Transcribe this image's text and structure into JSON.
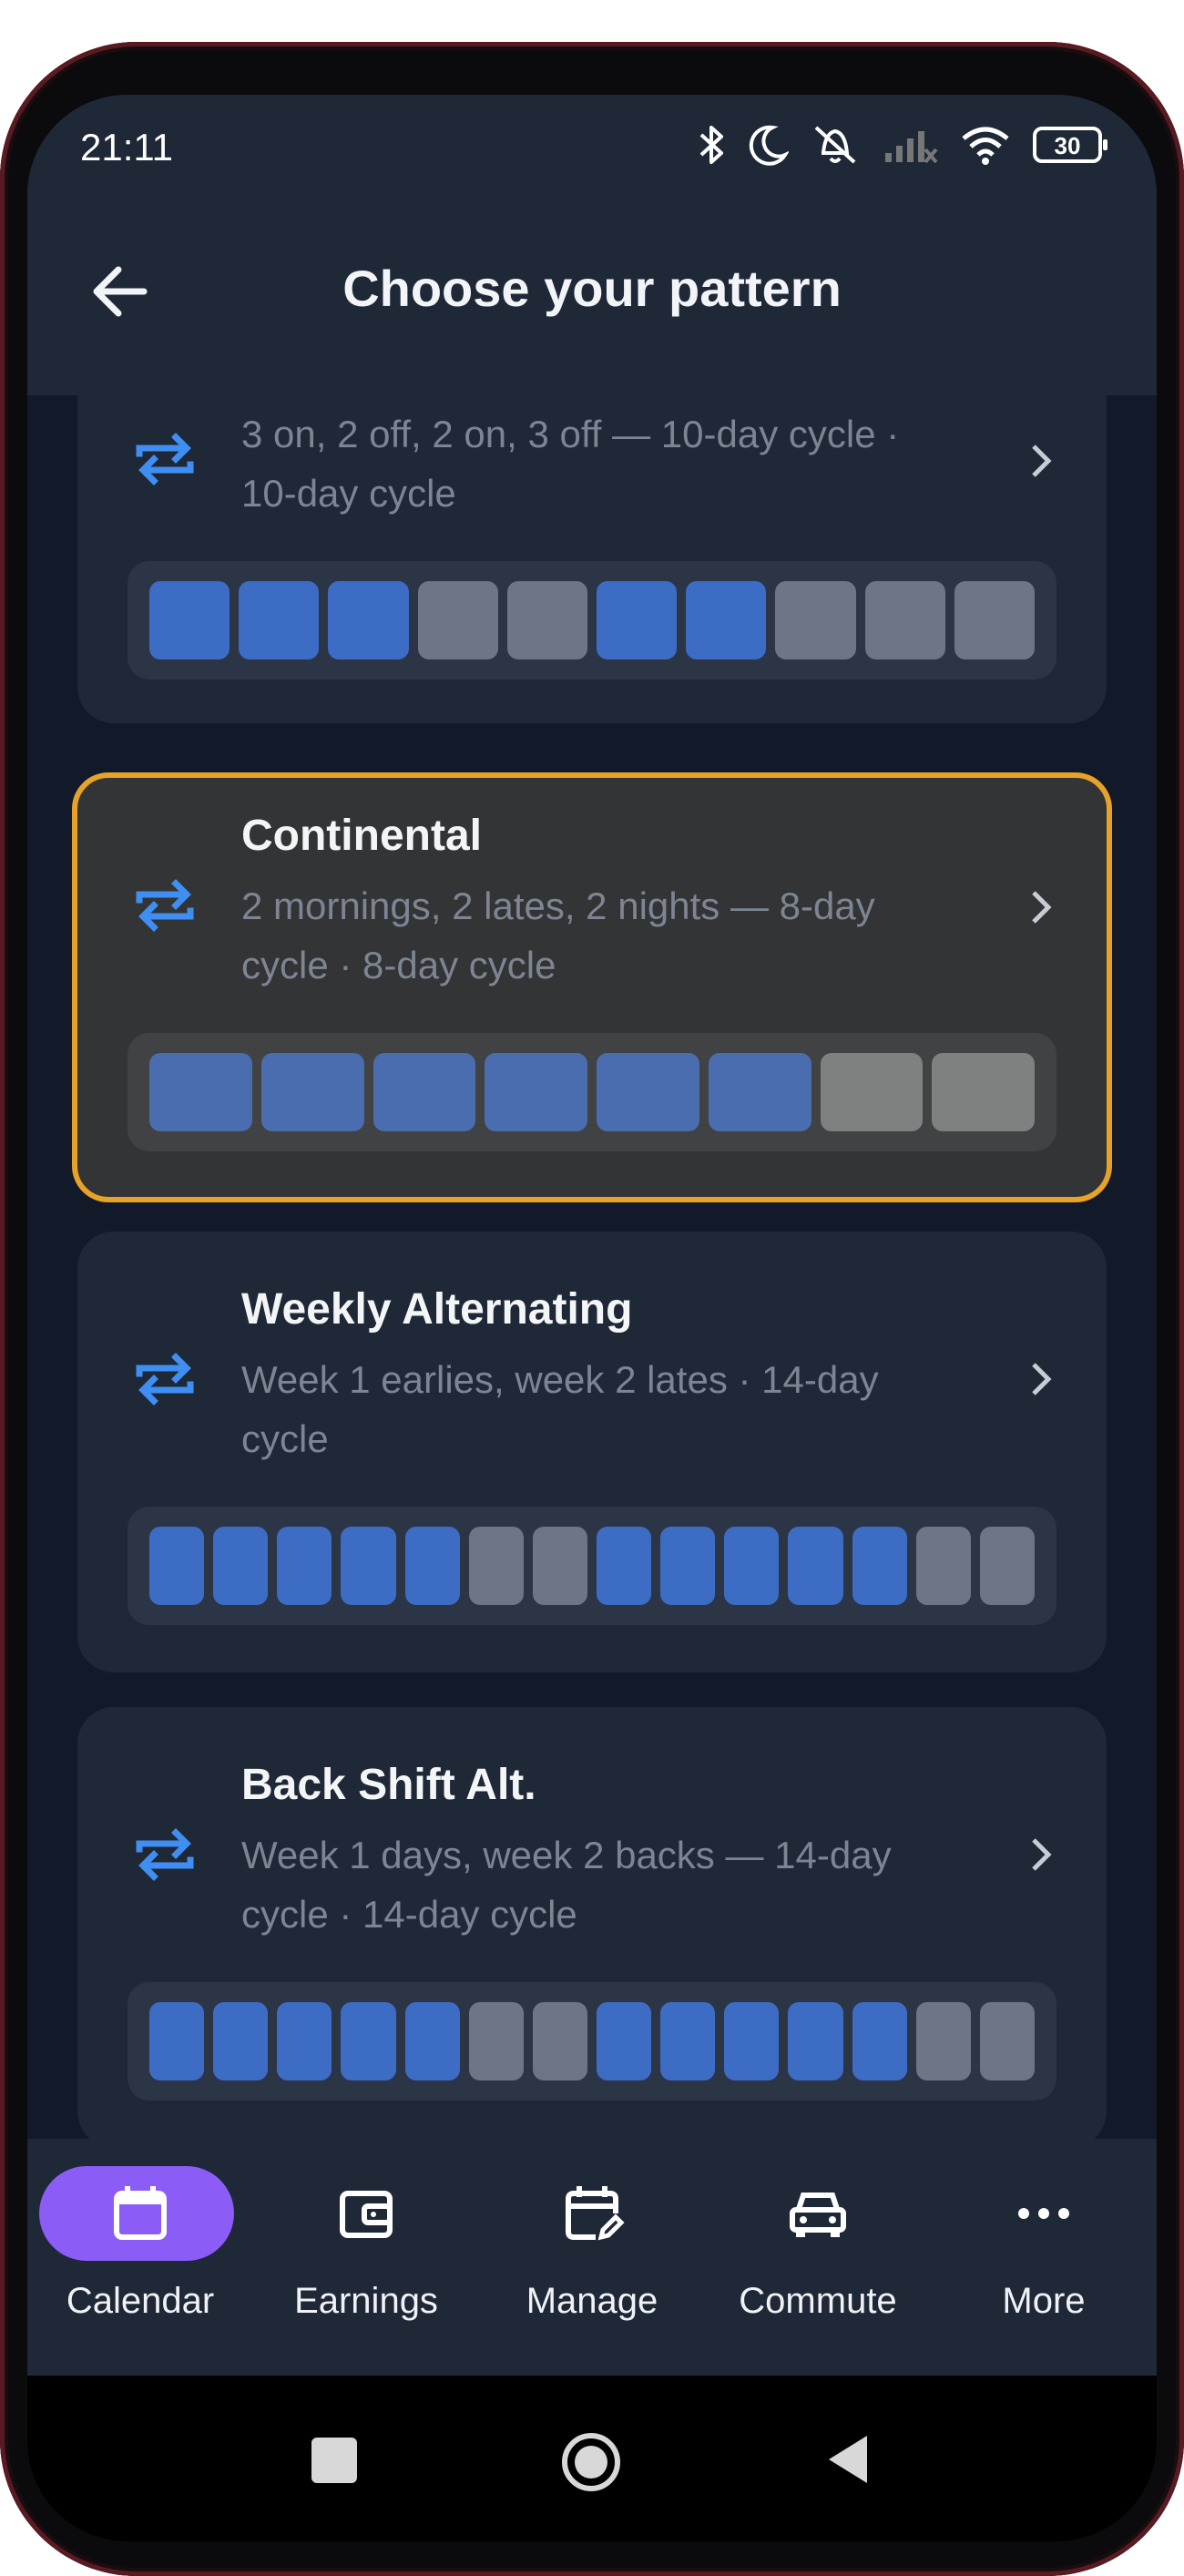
{
  "status": {
    "time": "21:11",
    "battery": "30",
    "icons": [
      "bluetooth-icon",
      "moon-icon",
      "mute-icon",
      "signal-icon",
      "wifi-icon",
      "battery-icon"
    ]
  },
  "appbar": {
    "title": "Choose your pattern",
    "back_icon": "arrow-left-icon"
  },
  "colors": {
    "accent": "#3d6cc4",
    "selected_border": "#e7a228",
    "nav_active": "#8b5cf6",
    "off_day": "#6e7584"
  },
  "patterns": [
    {
      "title": "",
      "description": "3 on, 2 off, 2 on, 3 off — 10-day cycle · 10-day cycle",
      "desc_line1": "3 on, 2 off, 2 on, 3 off — 10-day cycle ·",
      "desc_line2": "10-day cycle",
      "days": [
        1,
        1,
        1,
        0,
        0,
        1,
        1,
        0,
        0,
        0
      ]
    },
    {
      "title": "Continental",
      "description": "2 mornings, 2 lates, 2 nights — 8-day cycle · 8-day cycle",
      "desc_line1": "2 mornings, 2 lates, 2 nights — 8-day",
      "desc_line2": "cycle · 8-day cycle",
      "selected": true,
      "days": [
        1,
        1,
        1,
        1,
        1,
        1,
        0,
        0
      ]
    },
    {
      "title": "Weekly Alternating",
      "description": "Week 1 earlies, week 2 lates · 14-day cycle",
      "desc_line1": "Week 1 earlies, week 2 lates · 14-day",
      "desc_line2": "cycle",
      "days": [
        1,
        1,
        1,
        1,
        1,
        0,
        0,
        1,
        1,
        1,
        1,
        1,
        0,
        0
      ]
    },
    {
      "title": "Back Shift Alt.",
      "description": "Week 1 days, week 2 backs — 14-day cycle · 14-day cycle",
      "desc_line1": "Week 1 days, week 2 backs — 14-day",
      "desc_line2": "cycle · 14-day cycle",
      "days": [
        1,
        1,
        1,
        1,
        1,
        0,
        0,
        1,
        1,
        1,
        1,
        1,
        0,
        0
      ]
    }
  ],
  "bottom_nav": {
    "items": [
      {
        "label": "Calendar",
        "icon": "calendar-icon",
        "active": true
      },
      {
        "label": "Earnings",
        "icon": "wallet-icon"
      },
      {
        "label": "Manage",
        "icon": "calendar-edit-icon"
      },
      {
        "label": "Commute",
        "icon": "car-icon"
      },
      {
        "label": "More",
        "icon": "more-horizontal-icon"
      }
    ]
  },
  "system_nav": [
    "recents-square",
    "home-circle",
    "back-triangle"
  ]
}
